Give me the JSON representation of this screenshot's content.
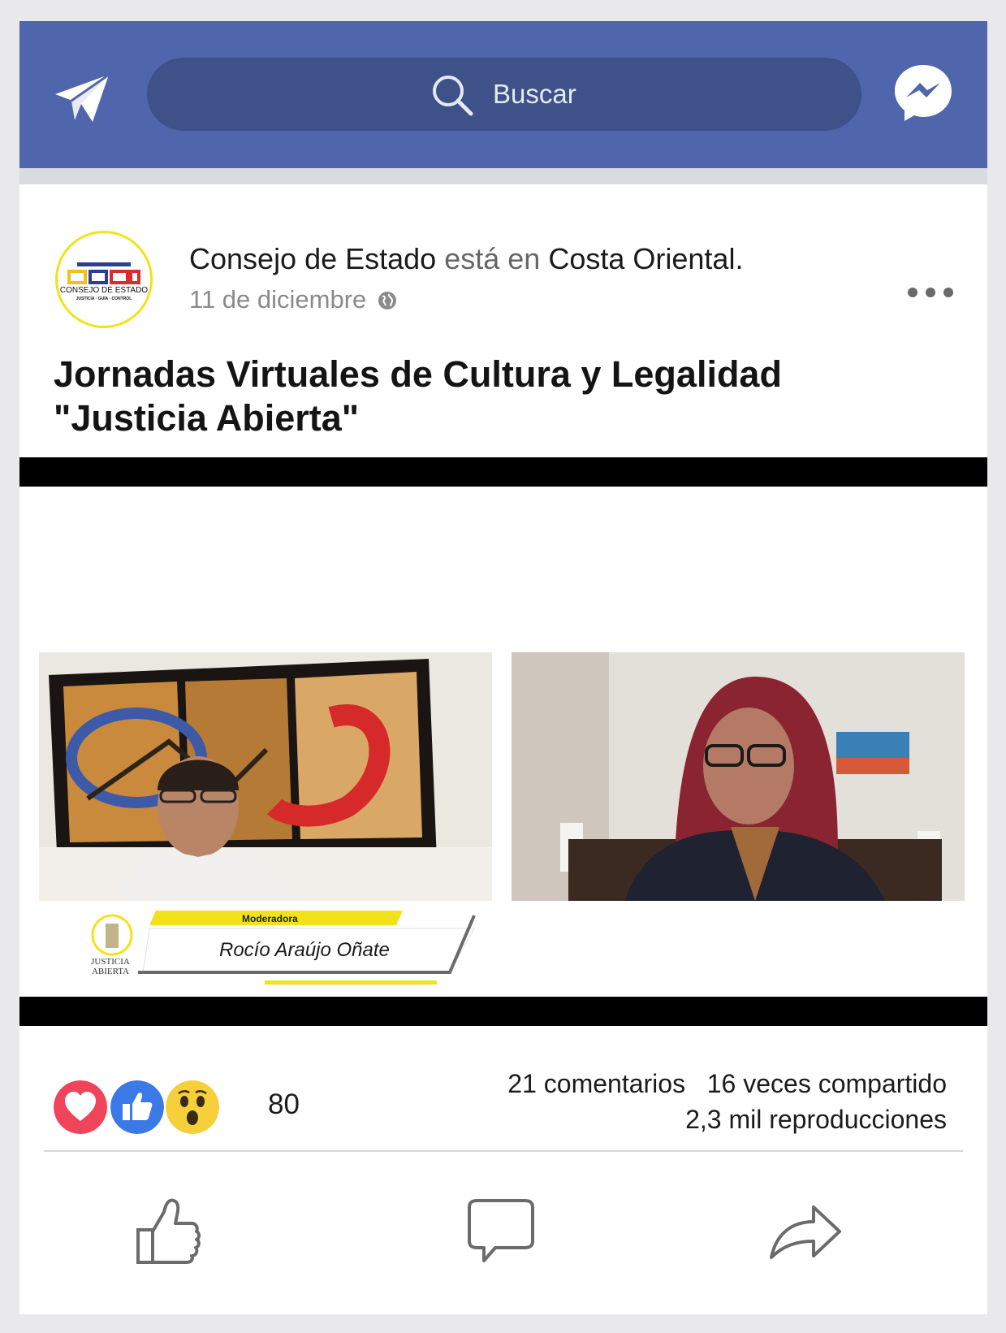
{
  "header": {
    "search_placeholder": "Buscar"
  },
  "post": {
    "author": "Consejo de Estado",
    "location_connector": "está en",
    "location": "Costa Oriental.",
    "date": "11 de diciembre",
    "title_line1": "Jornadas Virtuales de Cultura y Legalidad",
    "title_line2": "\"Justicia Abierta\"",
    "avatar_logo_text": "CONSEJO DE ESTADO",
    "avatar_logo_subtext": "JUSTICIA · GUÍA · CONTROL"
  },
  "video": {
    "lower_third_role": "Moderadora",
    "lower_third_name": "Rocío Araújo Oñate",
    "logo_line1": "JUSTICIA",
    "logo_line2": "ABIERTA"
  },
  "stats": {
    "reaction_count": "80",
    "comments": "21 comentarios",
    "shares": "16 veces compartido",
    "views": "2,3 mil  reproducciones"
  },
  "icons": [
    "send-icon",
    "search-icon",
    "messenger-icon",
    "globe-icon",
    "more-icon",
    "love-reaction-icon",
    "like-reaction-icon",
    "wow-reaction-icon",
    "like-icon",
    "comment-icon",
    "share-icon"
  ],
  "colors": {
    "header": "#4f66ad",
    "search": "#3e5189",
    "love": "#f0445a",
    "like": "#3b7ae6",
    "wow": "#f5d03a",
    "brand_yellow": "#f2e21a"
  }
}
